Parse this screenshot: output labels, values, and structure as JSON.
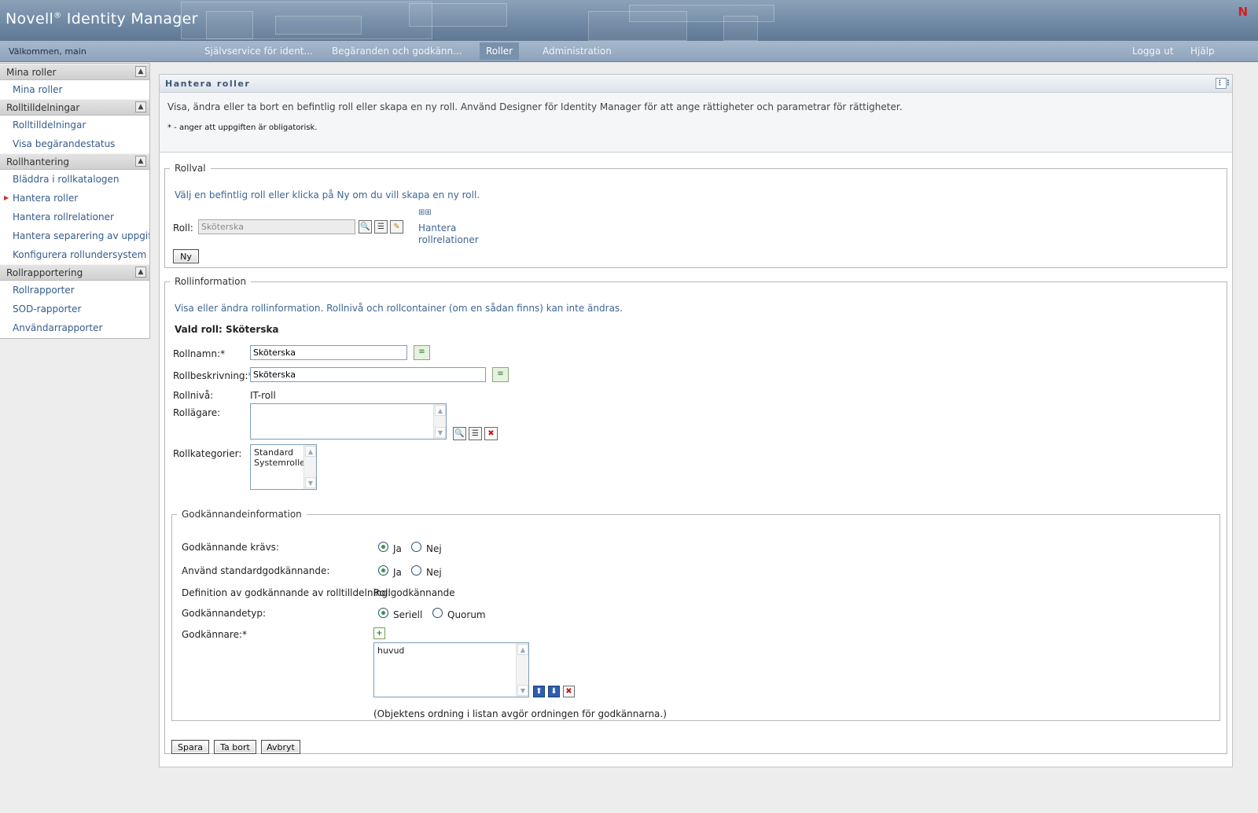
{
  "header": {
    "brand": "Novell",
    "registered": "®",
    "product": " Identity Manager",
    "corner_logo": "N"
  },
  "navbar": {
    "welcome": "Välkommen, main",
    "tabs": [
      {
        "label": "Självservice för ident..."
      },
      {
        "label": "Begäranden och godkänn..."
      },
      {
        "label": "Roller"
      },
      {
        "label": "Administration"
      }
    ],
    "logout": "Logga ut",
    "help": "Hjälp"
  },
  "sidebar": {
    "sections": [
      {
        "title": "Mina roller",
        "items": [
          "Mina roller"
        ]
      },
      {
        "title": "Rolltilldelningar",
        "items": [
          "Rolltilldelningar",
          "Visa begärandestatus"
        ]
      },
      {
        "title": "Rollhantering",
        "items": [
          "Bläddra i rollkatalogen",
          "Hantera roller",
          "Hantera rollrelationer",
          "Hantera separering av uppgifter",
          "Konfigurera rollundersystem"
        ]
      },
      {
        "title": "Rollrapportering",
        "items": [
          "Rollrapporter",
          "SOD-rapporter",
          "Användarrapporter"
        ]
      }
    ],
    "collapse_icon": "▲"
  },
  "main": {
    "title": "Hantera roller",
    "description": "Visa, ändra eller ta bort en befintlig roll eller skapa en ny roll. Använd Designer för Identity Manager för att ange rättigheter och parametrar för rättigheter.",
    "required_note": "* - anger att uppgiften är obligatorisk.",
    "rollval": {
      "legend": "Rollval",
      "hint": "Välj en befintlig roll eller klicka på Ny om du vill skapa en ny roll.",
      "role_label": "Roll:",
      "role_value": "Sköterska",
      "manage_link_line1": "Hantera",
      "manage_link_line2": "rollrelationer",
      "new_button": "Ny"
    },
    "rollinfo": {
      "legend": "Rollinformation",
      "hint": "Visa eller ändra rollinformation. Rollnivå och rollcontainer (om en sådan finns) kan inte ändras.",
      "selected_role": "Vald roll: Sköterska",
      "name_label": "Rollnamn:*",
      "name_value": "Sköterska",
      "desc_label": "Rollbeskrivning:*",
      "desc_value": "Sköterska",
      "level_label": "Rollnivå:",
      "level_value": "IT-roll",
      "owner_label": "Rollägare:",
      "categories_label": "Rollkategorier:",
      "categories": [
        "Standard",
        "Systemroller"
      ]
    },
    "approval": {
      "legend": "Godkännandeinformation",
      "required_label": "Godkännande krävs:",
      "default_label": "Använd standardgodkännande:",
      "definition_label": "Definition av godkännande av rolltilldelning:",
      "definition_value": "Rollgodkännande",
      "type_label": "Godkännandetyp:",
      "approvers_label": "Godkännare:*",
      "approvers": [
        "huvud"
      ],
      "yes": "Ja",
      "no": "Nej",
      "serial": "Seriell",
      "quorum": "Quorum",
      "order_note": "(Objektens ordning i listan avgör ordningen för godkännarna.)"
    },
    "buttons": {
      "save": "Spara",
      "delete": "Ta bort",
      "cancel": "Avbryt"
    }
  }
}
